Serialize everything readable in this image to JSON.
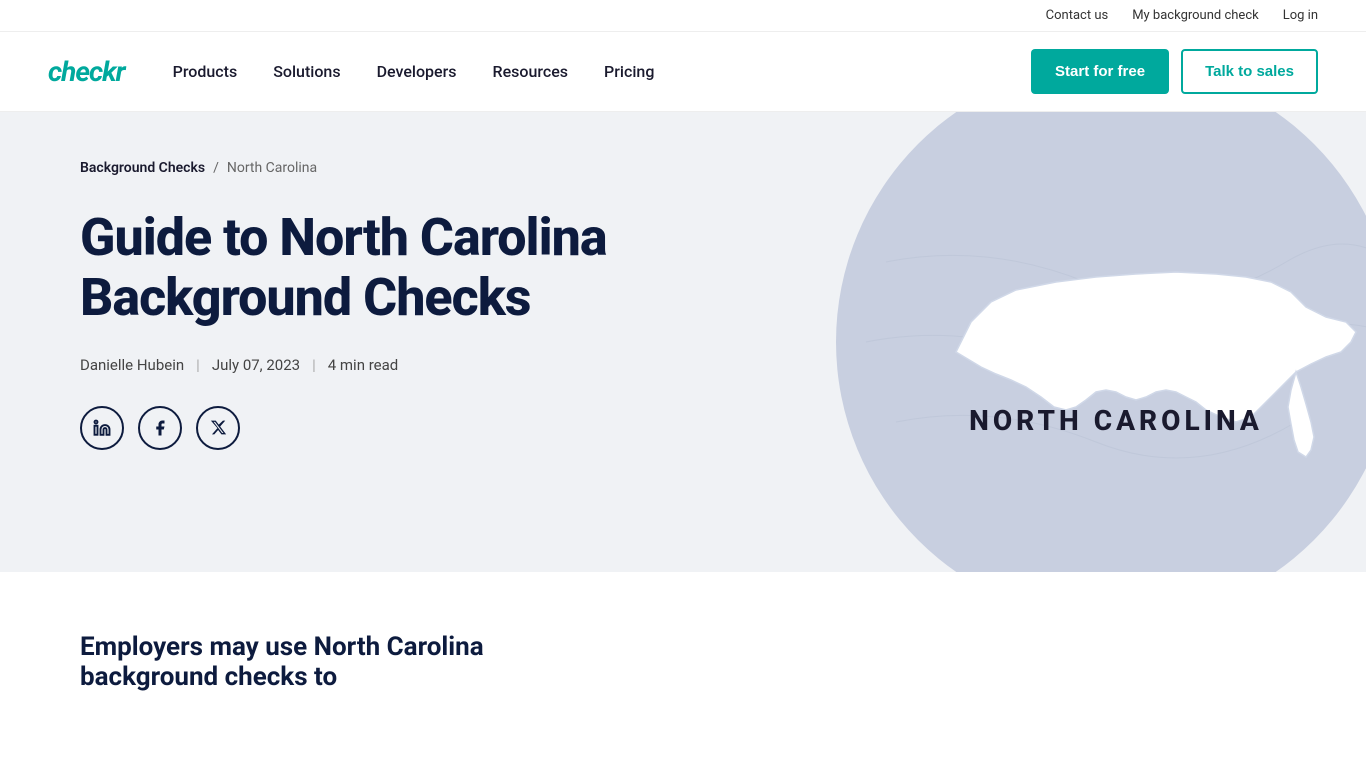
{
  "topbar": {
    "contact_label": "Contact us",
    "background_check_label": "My background check",
    "login_label": "Log in"
  },
  "navbar": {
    "logo": "checkr",
    "links": [
      {
        "id": "products",
        "label": "Products"
      },
      {
        "id": "solutions",
        "label": "Solutions"
      },
      {
        "id": "developers",
        "label": "Developers"
      },
      {
        "id": "resources",
        "label": "Resources"
      },
      {
        "id": "pricing",
        "label": "Pricing"
      }
    ],
    "cta_primary": "Start for free",
    "cta_secondary": "Talk to sales"
  },
  "breadcrumb": {
    "parent_label": "Background Checks",
    "separator": "/",
    "current": "North Carolina"
  },
  "hero": {
    "title": "Guide to North Carolina Background Checks",
    "author": "Danielle Hubein",
    "date": "July 07, 2023",
    "read_time": "4 min read",
    "divider": "|",
    "state_label": "NORTH CAROLINA"
  },
  "social": {
    "linkedin_label": "in",
    "facebook_label": "f",
    "x_label": "✕"
  },
  "bottom": {
    "title": "Employers may use North Carolina background checks to"
  },
  "colors": {
    "teal": "#00a99d",
    "dark_navy": "#0d1b3e",
    "light_bg": "#f0f2f5",
    "circle_bg": "#c8cfe0"
  }
}
